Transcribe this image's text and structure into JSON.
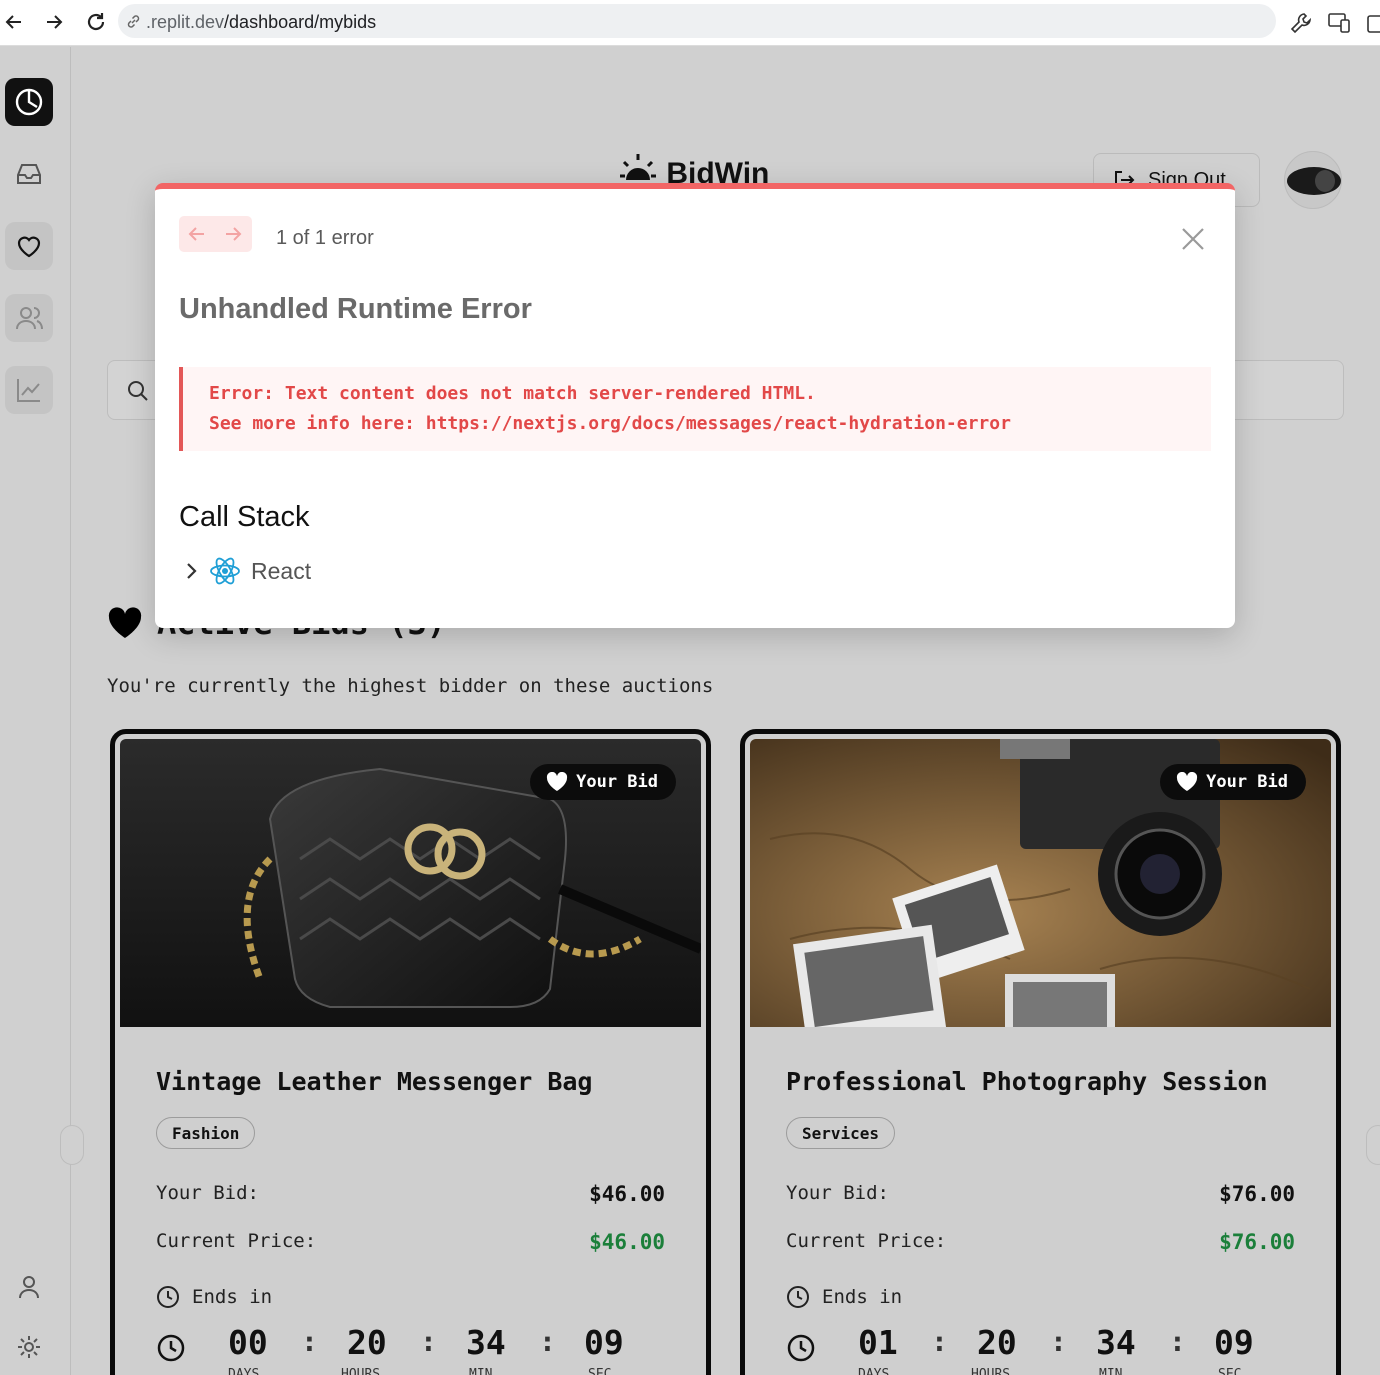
{
  "browser": {
    "url_prefix": ".replit.dev",
    "url_path": "/dashboard/mybids"
  },
  "header": {
    "logo_text": "BidWin",
    "sign_out_label": "Sign Out"
  },
  "section": {
    "title": "Active Bids (3)",
    "subtitle": "You're currently the highest bidder on these auctions"
  },
  "cards": [
    {
      "badge": "Your Bid",
      "title": "Vintage Leather Messenger Bag",
      "tag": "Fashion",
      "your_bid_label": "Your Bid:",
      "your_bid": "$46.00",
      "current_price_label": "Current Price:",
      "current_price": "$46.00",
      "ends_label": "Ends in",
      "countdown": {
        "days": "00",
        "hours": "20",
        "min": "34",
        "sec": "09"
      },
      "labels": {
        "days": "DAYS",
        "hours": "HOURS",
        "min": "MIN",
        "sec": "SEC"
      }
    },
    {
      "badge": "Your Bid",
      "title": "Professional Photography Session",
      "tag": "Services",
      "your_bid_label": "Your Bid:",
      "your_bid": "$76.00",
      "current_price_label": "Current Price:",
      "current_price": "$76.00",
      "ends_label": "Ends in",
      "countdown": {
        "days": "01",
        "hours": "20",
        "min": "34",
        "sec": "09"
      },
      "labels": {
        "days": "DAYS",
        "hours": "HOURS",
        "min": "MIN",
        "sec": "SEC"
      }
    }
  ],
  "modal": {
    "error_count": "1 of 1 error",
    "heading": "Unhandled Runtime Error",
    "error_line1": "Error: Text content does not match server-rendered HTML.",
    "error_line2": "See more info here: https://nextjs.org/docs/messages/react-hydration-error",
    "call_stack_title": "Call Stack",
    "frame_label": "React"
  },
  "colors": {
    "accent_red": "#f26565",
    "error_text": "#e24848",
    "price_green": "#1b7f3a"
  }
}
